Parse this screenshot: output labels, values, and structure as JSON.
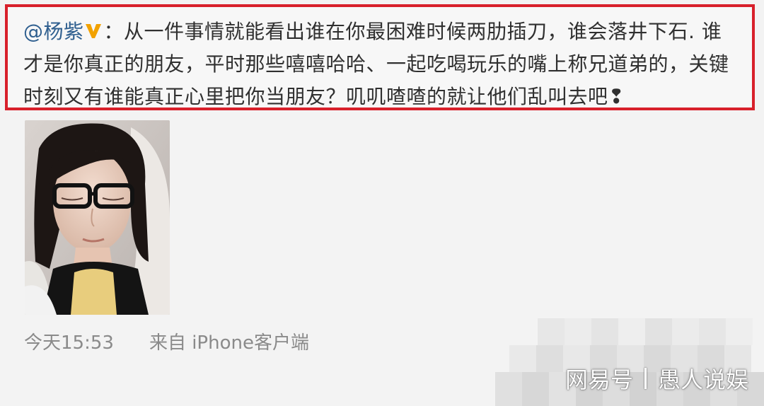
{
  "post": {
    "mention": "@杨紫",
    "colon": "：",
    "body": "从一件事情就能看出谁在你最困难时候两肋插刀，谁会落井下石. 谁才是你真正的朋友，平时那些嘻嘻哈哈、一起吃喝玩乐的嘴上称兄道弟的，关键时刻又有谁能真正心里把你当朋友？叽叽喳喳的就让他们乱叫去吧❢"
  },
  "meta": {
    "time": "今天15:53",
    "source": "来自 iPhone客户端"
  },
  "watermark": {
    "platform": "网易号",
    "account": "愚人说娱"
  },
  "colors": {
    "highlight_border": "#d8202b",
    "mention": "#2f5f8f",
    "verified_badge": "#f2a200",
    "meta_text": "#8a8a8a"
  },
  "icons": {
    "verified": "verified-v-icon"
  }
}
